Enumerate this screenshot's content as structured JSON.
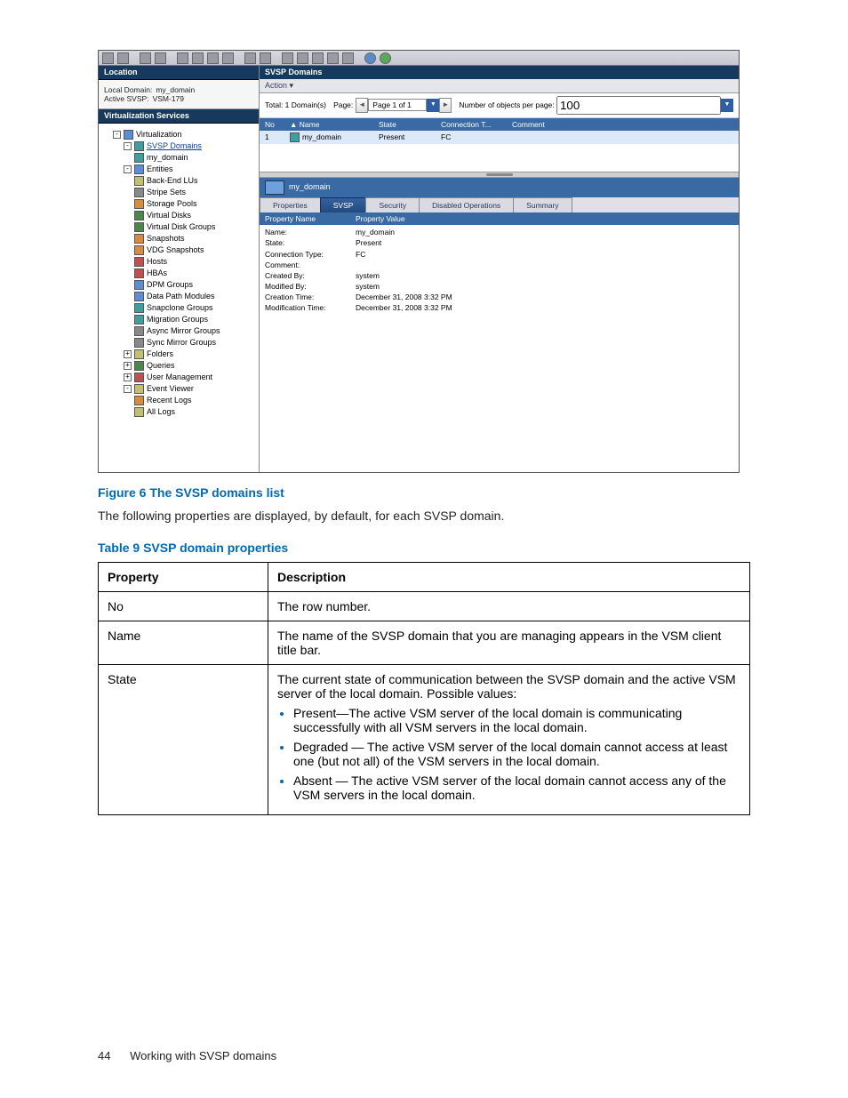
{
  "location_panel": {
    "header": "Location",
    "local_domain_label": "Local Domain:",
    "local_domain_value": "my_domain",
    "active_svsp_label": "Active SVSP:",
    "active_svsp_value": "VSM-179"
  },
  "vs_panel": {
    "header": "Virtualization Services"
  },
  "tree": {
    "virtualization": "Virtualization",
    "svsp_domains": "SVSP Domains",
    "my_domain": "my_domain",
    "entities": "Entities",
    "back_end_lus": "Back-End LUs",
    "stripe_sets": "Stripe Sets",
    "storage_pools": "Storage Pools",
    "virtual_disks": "Virtual Disks",
    "virtual_disk_groups": "Virtual Disk Groups",
    "snapshots": "Snapshots",
    "vdg_snapshots": "VDG Snapshots",
    "hosts": "Hosts",
    "hbas": "HBAs",
    "dpm_groups": "DPM Groups",
    "data_path_modules": "Data Path Modules",
    "snapclone_groups": "Snapclone Groups",
    "migration_groups": "Migration Groups",
    "async_mirror_groups": "Async Mirror Groups",
    "sync_mirror_groups": "Sync Mirror Groups",
    "folders": "Folders",
    "queries": "Queries",
    "user_management": "User Management",
    "event_viewer": "Event Viewer",
    "recent_logs": "Recent Logs",
    "all_logs": "All Logs"
  },
  "listpane": {
    "header": "SVSP Domains",
    "action_label": "Action",
    "total_text": "Total: 1 Domain(s)",
    "page_label": "Page:",
    "page_field": "Page 1 of 1",
    "objects_label": "Number of objects per page:",
    "objects_value": "100",
    "cols": {
      "no": "No",
      "name": "Name",
      "state": "State",
      "conn": "Connection T...",
      "comment": "Comment"
    },
    "row": {
      "no": "1",
      "name": "my_domain",
      "state": "Present",
      "conn": "FC",
      "comment": ""
    }
  },
  "detail": {
    "title": "my_domain",
    "tabs": {
      "properties": "Properties",
      "svsp": "SVSP",
      "security": "Security",
      "disabled_ops": "Disabled Operations",
      "summary": "Summary"
    },
    "kv_head": {
      "name": "Property Name",
      "value": "Property Value"
    },
    "rows": [
      {
        "k": "Name:",
        "v": "my_domain"
      },
      {
        "k": "State:",
        "v": "Present"
      },
      {
        "k": "Connection Type:",
        "v": "FC"
      },
      {
        "k": "Comment:",
        "v": ""
      },
      {
        "k": "Created By:",
        "v": "system"
      },
      {
        "k": "Modified By:",
        "v": "system"
      },
      {
        "k": "Creation Time:",
        "v": "December 31, 2008 3:32 PM"
      },
      {
        "k": "Modification Time:",
        "v": "December 31, 2008 3:32 PM"
      }
    ]
  },
  "doc": {
    "fig_caption": "Figure 6 The SVSP domains list",
    "intro": "The following properties are displayed, by default, for each SVSP domain.",
    "table_caption": "Table 9 SVSP domain properties",
    "th_property": "Property",
    "th_description": "Description",
    "r_no_p": "No",
    "r_no_d": "The row number.",
    "r_name_p": "Name",
    "r_name_d": "The name of the SVSP domain that you are managing appears in the VSM client title bar.",
    "r_state_p": "State",
    "r_state_intro": "The current state of communication between the SVSP domain and the active VSM server of the local domain. Possible values:",
    "r_state_b1": "Present—The active VSM server of the local domain is communicating successfully with all VSM servers in the local domain.",
    "r_state_b2": "Degraded — The active VSM server of the local domain cannot access at least one (but not all) of the VSM servers in the local domain.",
    "r_state_b3": "Absent — The active VSM server of the local domain cannot access any of the VSM servers in the local domain.",
    "page_num": "44",
    "section": "Working with SVSP domains"
  }
}
